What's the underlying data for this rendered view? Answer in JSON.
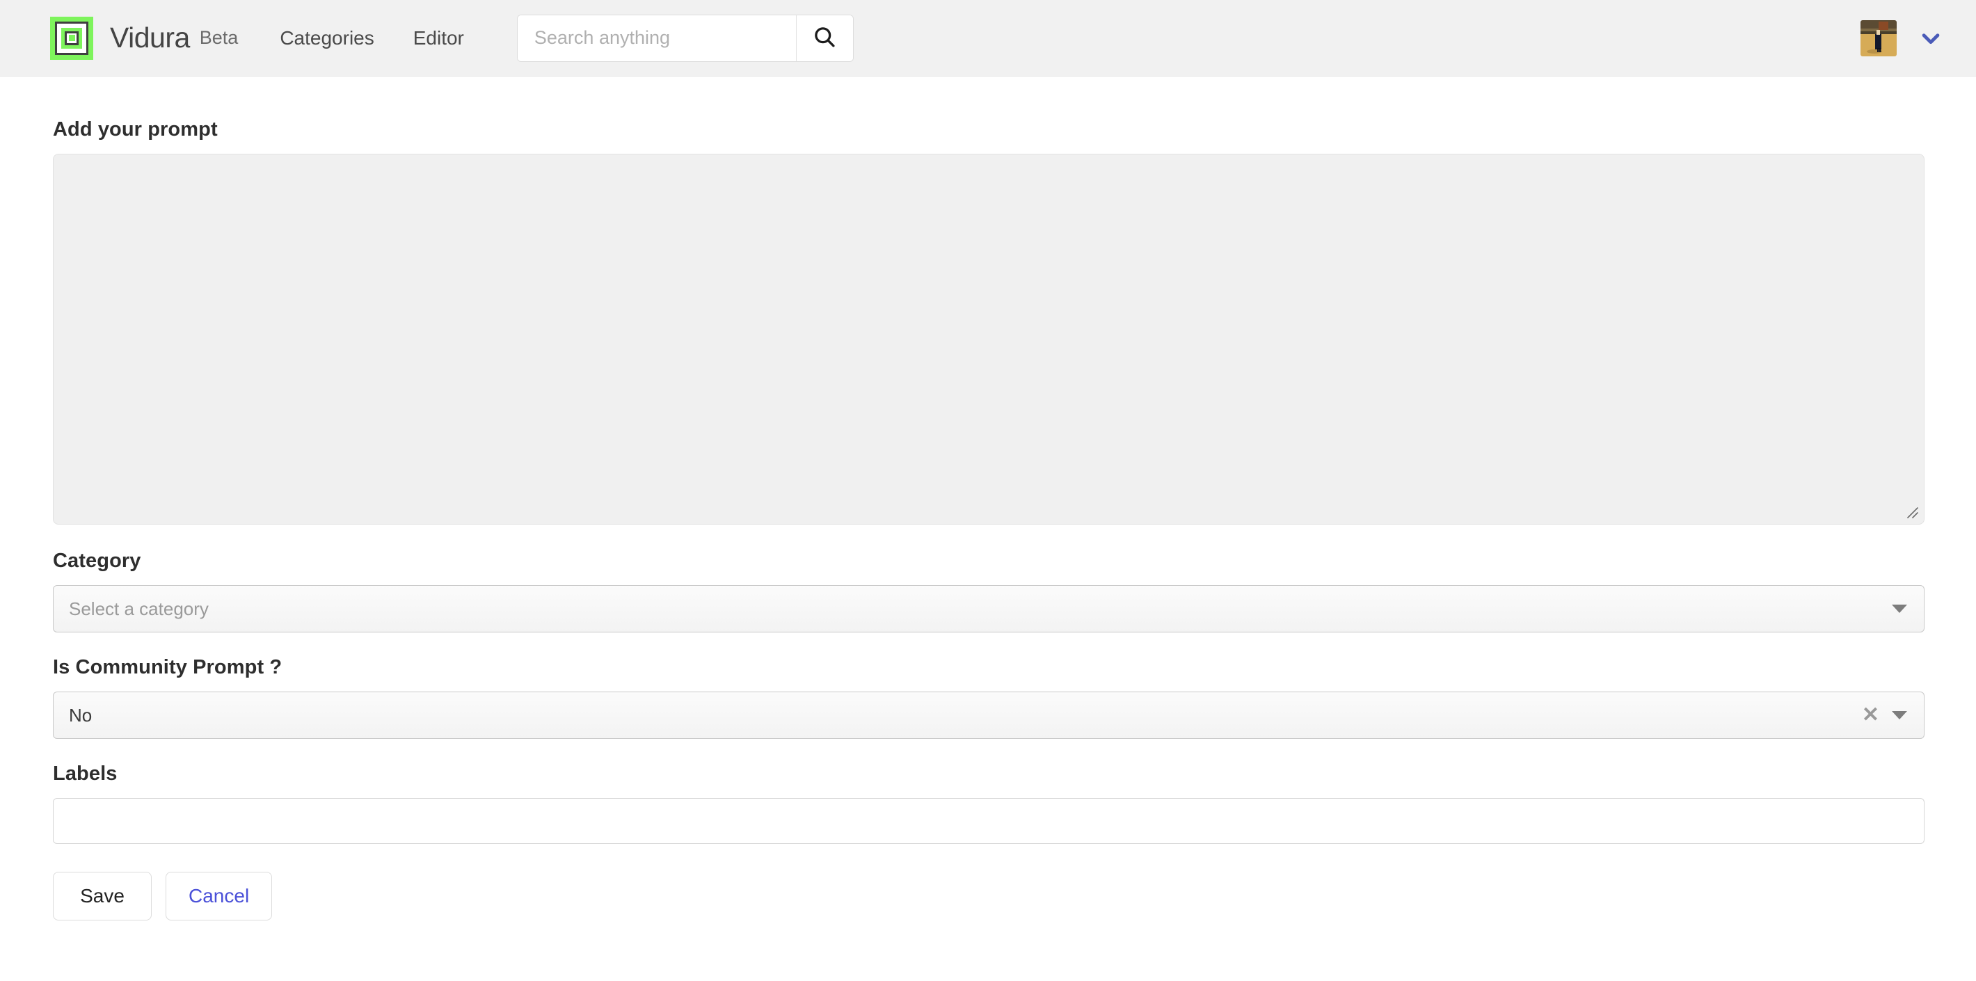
{
  "header": {
    "brand_name": "Vidura",
    "brand_badge": "Beta",
    "logo_icon": "nested-squares-logo-icon",
    "nav": [
      {
        "label": "Categories",
        "name": "nav-link-categories"
      },
      {
        "label": "Editor",
        "name": "nav-link-editor"
      }
    ],
    "search": {
      "placeholder": "Search anything",
      "value": "",
      "button_icon": "search-icon"
    },
    "account": {
      "avatar_icon": "user-avatar",
      "chevron_icon": "chevron-down-icon"
    },
    "colors": {
      "bar_background": "#f1f1f1",
      "logo_green": "#7ef45c",
      "chevron_blue": "#4a5bb8"
    }
  },
  "form": {
    "prompt": {
      "label": "Add your prompt",
      "value": "",
      "placeholder": "",
      "resize_icon": "resize-grip-icon"
    },
    "category": {
      "label": "Category",
      "selected": "Select a category",
      "is_placeholder": true,
      "caret_icon": "caret-down-icon"
    },
    "community_prompt": {
      "label": "Is Community Prompt ?",
      "selected": "No",
      "clear_icon": "clear-x-icon",
      "caret_icon": "caret-down-icon"
    },
    "labels": {
      "label": "Labels",
      "value": "",
      "placeholder": ""
    },
    "actions": {
      "save_label": "Save",
      "cancel_label": "Cancel",
      "cancel_color": "#4a50d8"
    }
  }
}
